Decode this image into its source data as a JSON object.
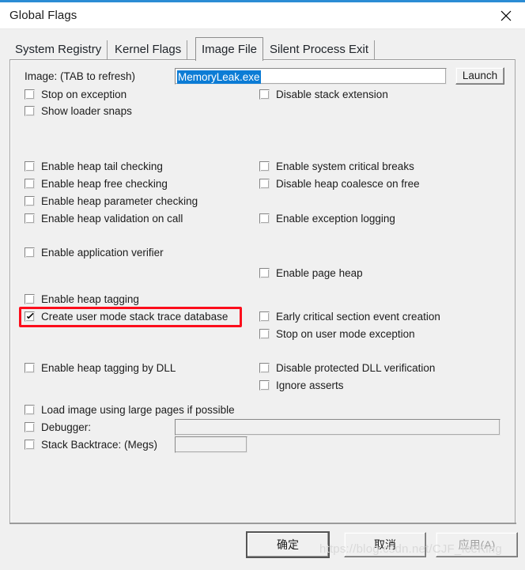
{
  "window": {
    "title": "Global Flags",
    "close_icon": "close-icon",
    "accent_color": "#2b8cd4"
  },
  "tabs": [
    {
      "label": "System Registry",
      "active": false
    },
    {
      "label": "Kernel Flags",
      "active": false
    },
    {
      "label": "Image File",
      "active": true
    },
    {
      "label": "Silent Process Exit",
      "active": false
    }
  ],
  "image_section": {
    "label": "Image: (TAB to refresh)",
    "input_value": "MemoryLeak.exe",
    "input_placeholder": "",
    "input_selected": true,
    "selection_color": "#0c7cd5",
    "launch_label": "Launch"
  },
  "checkboxes": {
    "left": [
      {
        "label": "Stop on exception",
        "checked": false
      },
      {
        "label": "Show loader snaps",
        "checked": false
      },
      {
        "label": "Enable heap tail checking",
        "checked": false
      },
      {
        "label": "Enable heap free checking",
        "checked": false
      },
      {
        "label": "Enable heap parameter checking",
        "checked": false
      },
      {
        "label": "Enable heap validation on call",
        "checked": false
      },
      {
        "label": "Enable application verifier",
        "checked": false
      },
      {
        "label": "Enable heap tagging",
        "checked": false
      },
      {
        "label": "Create user mode stack trace database",
        "checked": true
      },
      {
        "label": "Enable heap tagging by DLL",
        "checked": false
      },
      {
        "label": "Load image using large pages if possible",
        "checked": false
      },
      {
        "label": "Debugger:",
        "checked": false
      },
      {
        "label": "Stack Backtrace: (Megs)",
        "checked": false
      }
    ],
    "right": [
      {
        "label": "Disable stack extension",
        "checked": false
      },
      {
        "label": "Enable system critical breaks",
        "checked": false
      },
      {
        "label": "Disable heap coalesce on free",
        "checked": false
      },
      {
        "label": "Enable exception logging",
        "checked": false
      },
      {
        "label": "Enable page heap",
        "checked": false
      },
      {
        "label": "Early critical section event creation",
        "checked": false
      },
      {
        "label": "Stop on user mode exception",
        "checked": false
      },
      {
        "label": "Disable protected DLL verification",
        "checked": false
      },
      {
        "label": "Ignore asserts",
        "checked": false
      }
    ]
  },
  "fields": {
    "debugger_value": "",
    "debugger_enabled": false,
    "stack_backtrace_value": "",
    "stack_backtrace_enabled": false
  },
  "dialog_buttons": {
    "ok": "确定",
    "cancel": "取消",
    "apply": "应用(A)",
    "apply_enabled": false
  },
  "annotation": {
    "highlight_color": "#fc0d1b",
    "highlight_target": "Create user mode stack trace database"
  },
  "watermark": {
    "text": "https://blog.csdn.net/CJF_IceKing"
  }
}
